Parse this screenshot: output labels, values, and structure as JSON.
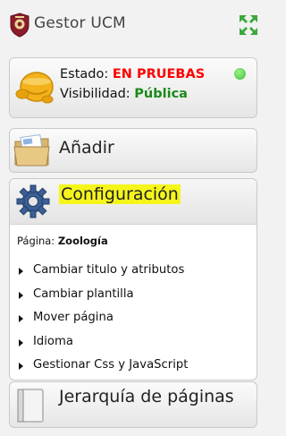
{
  "header": {
    "title": "Gestor UCM"
  },
  "status": {
    "estado_label": "Estado:",
    "estado_value": "EN PRUEBAS",
    "visibilidad_label": "Visibilidad:",
    "visibilidad_value": "Pública"
  },
  "add": {
    "label": "Añadir"
  },
  "config": {
    "label": "Configuración",
    "page_label": "Página:",
    "page_value": "Zoología",
    "items": [
      {
        "label": "Cambiar titulo y atributos"
      },
      {
        "label": "Cambiar plantilla"
      },
      {
        "label": "Mover página"
      },
      {
        "label": "Idioma"
      },
      {
        "label": "Gestionar Css y JavaScript"
      }
    ]
  },
  "tree": {
    "label": "Jerarquía de páginas"
  },
  "icons": {
    "crest": "university-crest-icon",
    "expand": "expand-arrows-icon",
    "status": "status-face-icon",
    "dot": "green-status-dot",
    "folder": "folder-icon",
    "gear": "gear-icon",
    "book": "book-icon"
  },
  "colors": {
    "estado_value": "#ff0000",
    "visibilidad_value": "#1a8a1a",
    "highlight": "#f5f51c",
    "status_dot": "#3cc13a"
  }
}
